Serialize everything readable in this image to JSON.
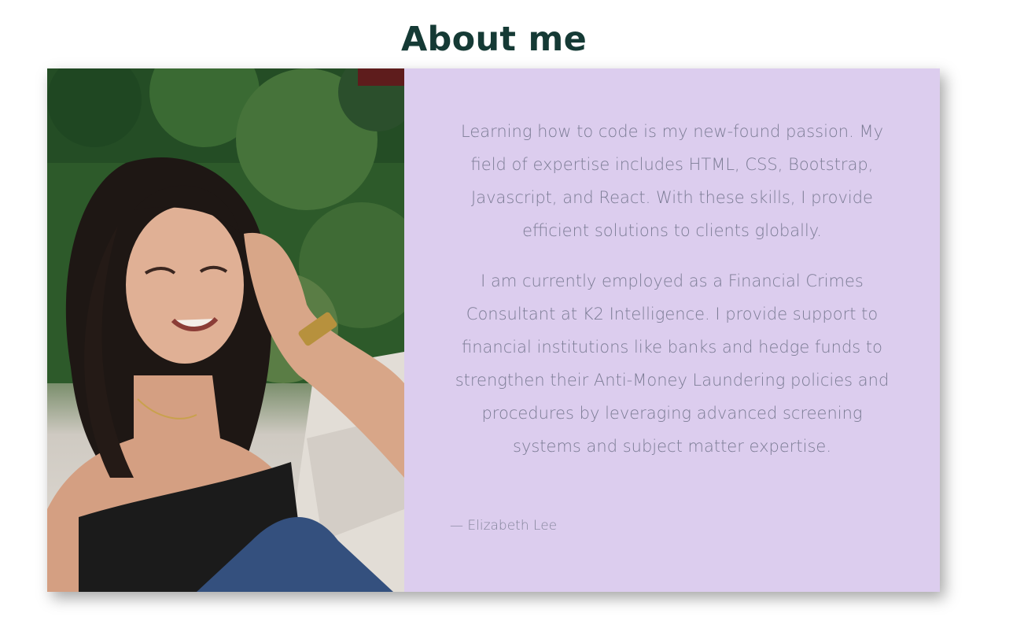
{
  "section": {
    "title": "About me"
  },
  "about": {
    "paragraphs": [
      "Learning how to code is my new-found passion. My field of expertise includes HTML, CSS, Bootstrap, Javascript, and React. With these skills, I provide efficient solutions to clients globally.",
      "I am currently employed as a Financial Crimes Consultant at K2 Intelligence. I provide support to financial institutions like banks and hedge funds to strengthen their Anti-Money Laundering policies and procedures by leveraging advanced screening systems and subject matter expertise."
    ],
    "signature": "— Elizabeth Lee"
  },
  "colors": {
    "title": "#153a35",
    "panel_background": "#dccdee",
    "panel_text": "#7d7d96"
  }
}
